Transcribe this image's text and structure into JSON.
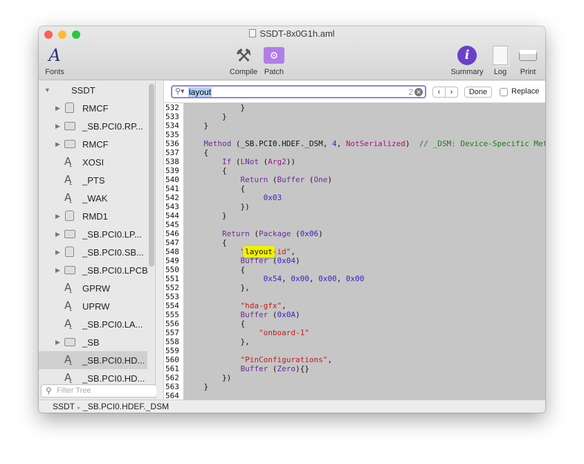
{
  "window": {
    "title": "SSDT-8x0G1h.aml",
    "colors": {
      "close": "#fe5f57",
      "minimize": "#febc2e",
      "zoom": "#28c840"
    }
  },
  "toolbar": {
    "fonts": "Fonts",
    "compile": "Compile",
    "patch": "Patch",
    "summary": "Summary",
    "log": "Log",
    "print": "Print"
  },
  "sidebar": {
    "root": "SSDT",
    "items": [
      {
        "label": "RMCF",
        "icon": "disk",
        "expandable": true
      },
      {
        "label": "_SB.PCI0.RP...",
        "icon": "folder",
        "expandable": true
      },
      {
        "label": "RMCF",
        "icon": "folder",
        "expandable": true
      },
      {
        "label": "XOSI",
        "icon": "method",
        "expandable": false
      },
      {
        "label": "_PTS",
        "icon": "method",
        "expandable": false
      },
      {
        "label": "_WAK",
        "icon": "method",
        "expandable": false
      },
      {
        "label": "RMD1",
        "icon": "disk",
        "expandable": true
      },
      {
        "label": "_SB.PCI0.LP...",
        "icon": "folder",
        "expandable": true
      },
      {
        "label": "_SB.PCI0.SB...",
        "icon": "disk",
        "expandable": true
      },
      {
        "label": "_SB.PCI0.LPCB",
        "icon": "folder",
        "expandable": true
      },
      {
        "label": "GPRW",
        "icon": "method",
        "expandable": false
      },
      {
        "label": "UPRW",
        "icon": "method",
        "expandable": false
      },
      {
        "label": "_SB.PCI0.LA...",
        "icon": "method",
        "expandable": false
      },
      {
        "label": "_SB",
        "icon": "folder",
        "expandable": true
      },
      {
        "label": "_SB.PCI0.HD...",
        "icon": "method",
        "expandable": false,
        "selected": true
      },
      {
        "label": "_SB.PCI0.HD...",
        "icon": "method",
        "expandable": false
      }
    ],
    "filter_placeholder": "Filter Tree"
  },
  "find": {
    "query": "layout",
    "count": "2",
    "done": "Done",
    "replace": "Replace",
    "replace_checked": false
  },
  "code": {
    "first_line": 532,
    "lines": [
      [
        [
          "p",
          "            }"
        ]
      ],
      [
        [
          "p",
          "        }"
        ]
      ],
      [
        [
          "p",
          "    }"
        ]
      ],
      [],
      [
        [
          "p",
          "    "
        ],
        [
          "k",
          "Method"
        ],
        [
          "p",
          " (_SB.PCI0.HDEF._DSM, "
        ],
        [
          "n",
          "4"
        ],
        [
          "p",
          ", "
        ],
        [
          "m",
          "NotSerialized"
        ],
        [
          "p",
          ")  "
        ],
        [
          "c",
          "// _DSM: Device-Specific Method"
        ]
      ],
      [
        [
          "p",
          "    {"
        ]
      ],
      [
        [
          "p",
          "        "
        ],
        [
          "k",
          "If"
        ],
        [
          "p",
          " ("
        ],
        [
          "k",
          "LNot"
        ],
        [
          "p",
          " ("
        ],
        [
          "m",
          "Arg2"
        ],
        [
          "p",
          "))"
        ]
      ],
      [
        [
          "p",
          "        {"
        ]
      ],
      [
        [
          "p",
          "            "
        ],
        [
          "k",
          "Return"
        ],
        [
          "p",
          " ("
        ],
        [
          "k",
          "Buffer"
        ],
        [
          "p",
          " ("
        ],
        [
          "k",
          "One"
        ],
        [
          "p",
          ")"
        ]
      ],
      [
        [
          "p",
          "            {"
        ]
      ],
      [
        [
          "p",
          "                 "
        ],
        [
          "n",
          "0x03"
        ]
      ],
      [
        [
          "p",
          "            })"
        ]
      ],
      [
        [
          "p",
          "        }"
        ]
      ],
      [],
      [
        [
          "p",
          "        "
        ],
        [
          "k",
          "Return"
        ],
        [
          "p",
          " ("
        ],
        [
          "k",
          "Package"
        ],
        [
          "p",
          " ("
        ],
        [
          "n",
          "0x06"
        ],
        [
          "p",
          ")"
        ]
      ],
      [
        [
          "p",
          "        {"
        ]
      ],
      [
        [
          "p",
          "            "
        ],
        [
          "s",
          "\""
        ],
        [
          "hl",
          "layout"
        ],
        [
          "s",
          "-id\""
        ],
        [
          "p",
          ","
        ]
      ],
      [
        [
          "p",
          "            "
        ],
        [
          "k",
          "Buffer"
        ],
        [
          "p",
          " ("
        ],
        [
          "n",
          "0x04"
        ],
        [
          "p",
          ")"
        ]
      ],
      [
        [
          "p",
          "            {"
        ]
      ],
      [
        [
          "p",
          "                 "
        ],
        [
          "n",
          "0x54"
        ],
        [
          "p",
          ", "
        ],
        [
          "n",
          "0x00"
        ],
        [
          "p",
          ", "
        ],
        [
          "n",
          "0x00"
        ],
        [
          "p",
          ", "
        ],
        [
          "n",
          "0x00"
        ]
      ],
      [
        [
          "p",
          "            },"
        ]
      ],
      [],
      [
        [
          "p",
          "            "
        ],
        [
          "s",
          "\"hda-gfx\""
        ],
        [
          "p",
          ","
        ]
      ],
      [
        [
          "p",
          "            "
        ],
        [
          "k",
          "Buffer"
        ],
        [
          "p",
          " ("
        ],
        [
          "n",
          "0x0A"
        ],
        [
          "p",
          ")"
        ]
      ],
      [
        [
          "p",
          "            {"
        ]
      ],
      [
        [
          "p",
          "                "
        ],
        [
          "s",
          "\"onboard-1\""
        ]
      ],
      [
        [
          "p",
          "            },"
        ]
      ],
      [],
      [
        [
          "p",
          "            "
        ],
        [
          "s",
          "\"PinConfigurations\""
        ],
        [
          "p",
          ","
        ]
      ],
      [
        [
          "p",
          "            "
        ],
        [
          "k",
          "Buffer"
        ],
        [
          "p",
          " ("
        ],
        [
          "k",
          "Zero"
        ],
        [
          "p",
          "){}"
        ]
      ],
      [
        [
          "p",
          "        })"
        ]
      ],
      [
        [
          "p",
          "    }"
        ]
      ],
      []
    ]
  },
  "status": {
    "path": [
      "SSDT",
      "_SB.PCI0.HDEF._DSM"
    ]
  }
}
